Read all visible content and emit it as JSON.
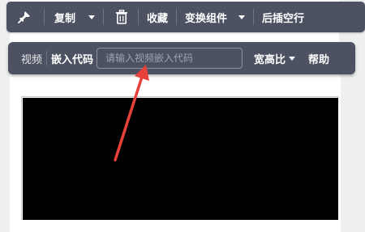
{
  "toolbar": {
    "copy_label": "复制",
    "favorite_label": "收藏",
    "transform_label": "变换组件",
    "insert_after_label": "后插空行"
  },
  "embed_bar": {
    "video_label": "视频",
    "embed_code_label": "嵌入代码",
    "input_placeholder": "请输入视频嵌入代码",
    "input_value": "",
    "aspect_ratio_label": "宽高比",
    "help_label": "帮助"
  },
  "icons": {
    "pin": "pin-icon",
    "trash": "trash-icon",
    "dropdown": "chevron-down-icon"
  },
  "colors": {
    "toolbar_bg": "#4c5261",
    "arrow": "#e8413a",
    "video_bg": "#000000"
  }
}
